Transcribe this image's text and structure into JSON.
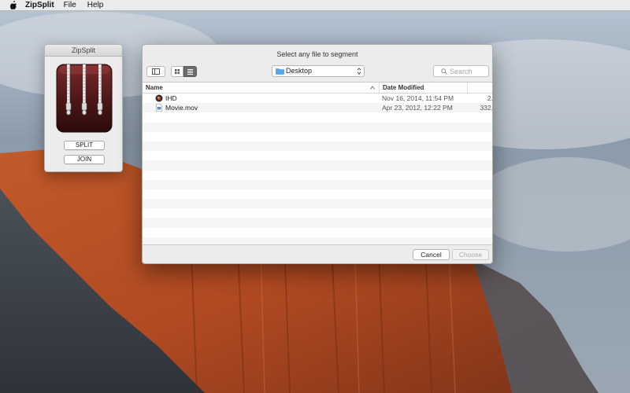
{
  "menubar": {
    "apple_icon": "apple-icon",
    "app_name": "ZipSplit",
    "items": [
      "File",
      "Help"
    ]
  },
  "zipsplit_window": {
    "title": "ZipSplit",
    "icon": "zipper-archive-icon",
    "split_label": "SPLIT",
    "join_label": "JOIN"
  },
  "dialog": {
    "title": "Select any file to segment",
    "toolbar": {
      "sidebar_toggle_icon": "sidebar-icon",
      "icon_view_icon": "grid-icon",
      "list_view_icon": "list-icon",
      "location": "Desktop",
      "location_icon": "folder-icon",
      "search_placeholder": "Search",
      "search_icon": "search-icon"
    },
    "columns": {
      "name": "Name",
      "date_modified": "Date Modified"
    },
    "files": [
      {
        "name": "IHD",
        "date": "Nov 16, 2014, 11:54 PM",
        "size": "2.",
        "icon": "app-icon"
      },
      {
        "name": "Movie.mov",
        "date": "Apr 23, 2012, 12:22 PM",
        "size": "332.",
        "icon": "movie-file-icon"
      }
    ],
    "buttons": {
      "cancel": "Cancel",
      "choose": "Choose"
    }
  },
  "colors": {
    "menubar_bg": "#ececec",
    "window_bg": "#ececec",
    "list_alt_row": "#f4f5f5",
    "disabled_text": "#aaaaaa"
  }
}
